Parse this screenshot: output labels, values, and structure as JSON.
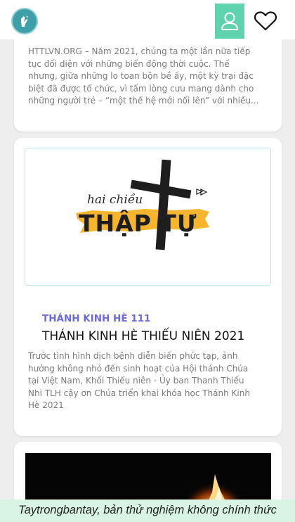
{
  "header": {
    "logo_icon": "praying-hands-icon",
    "user_icon": "user-icon",
    "heart_icon": "heart-icon",
    "accent_color": "#5fd3ad"
  },
  "posts": [
    {
      "excerpt": "HTTLVN.ORG – Năm 2021, chúng ta một lần nữa tiếp tục đối diện với những biến động thời cuộc. Thế nhưng, giữa những lo toan bộn bề ấy, một kỳ trại đặc biệt đã được tổ chức, vì tấm lòng cưu mang dành cho những người trẻ – “một thế hệ mới nổi lên” với nhiều..."
    },
    {
      "image": {
        "script_text": "hai chiều",
        "big_text": "THẬP TỰ",
        "icon": "cross-icon"
      },
      "category": "THÁNH KINH HÈ 111",
      "title": "THÁNH KINH HÈ THIẾU NIÊN 2021",
      "excerpt": "Trước tình hình dịch bệnh diễn biến phức tạp, ảnh hưởng không nhỏ đến sinh hoạt của Hội thánh Chúa tại Việt Nam, Khối Thiếu niên - Ủy ban Thanh Thiếu Nhi TLH cậy ơn Chúa triển khai khóa học Thánh Kinh Hè 2021"
    },
    {
      "image": {
        "icon": "fire-image"
      }
    }
  ],
  "footer": {
    "text": "Taytrongbantay, bản thử nghiệm không chính thức"
  }
}
